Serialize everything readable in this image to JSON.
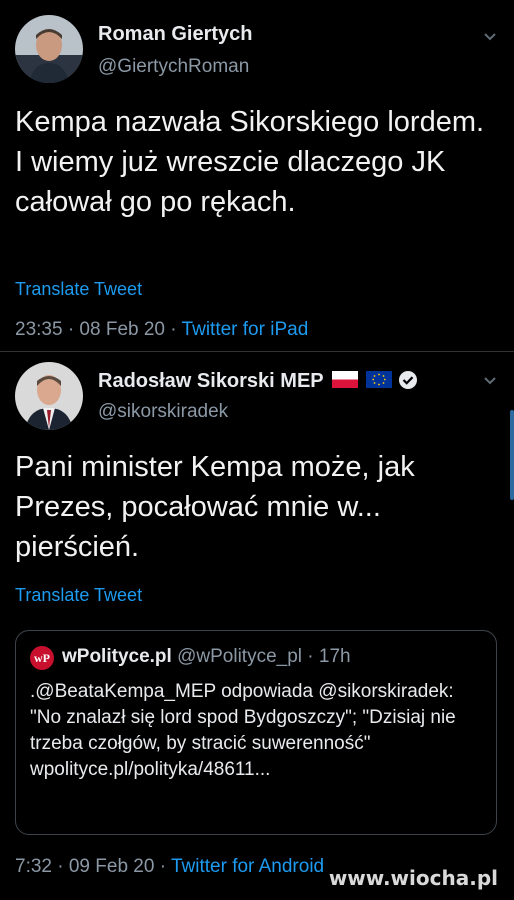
{
  "tweet1": {
    "name": "Roman Giertych",
    "handle": "@GiertychRoman",
    "text": "Kempa nazwała Sikorskiego lordem. I wiemy już wreszcie dlaczego JK całował go po rękach.",
    "translate": "Translate Tweet",
    "time": "23:35 · 08 Feb 20 · ",
    "source": "Twitter for iPad"
  },
  "tweet2": {
    "name": "Radosław Sikorski MEP",
    "handle": "@sikorskiradek",
    "text": "Pani minister Kempa może, jak Prezes, pocałować mnie w... pierścień.",
    "translate": "Translate Tweet",
    "time": "7:32 · 09 Feb 20 · ",
    "source": "Twitter for Android",
    "quote": {
      "logo": "wP",
      "name": "wPolityce.pl",
      "handle": "@wPolityce_pl",
      "age": "· 17h",
      "text": ".@BeataKempa_MEP odpowiada @sikorskiradek: \"No znalazł się lord spod Bydgoszczy\"; \"Dzisiaj nie trzeba czołgów, by stracić suwerenność\" wpolityce.pl/polityka/48611..."
    }
  },
  "watermark": "www.wiocha.pl",
  "colors": {
    "background": "#000000",
    "link": "#1d9bf0",
    "muted": "#8b98a5"
  }
}
